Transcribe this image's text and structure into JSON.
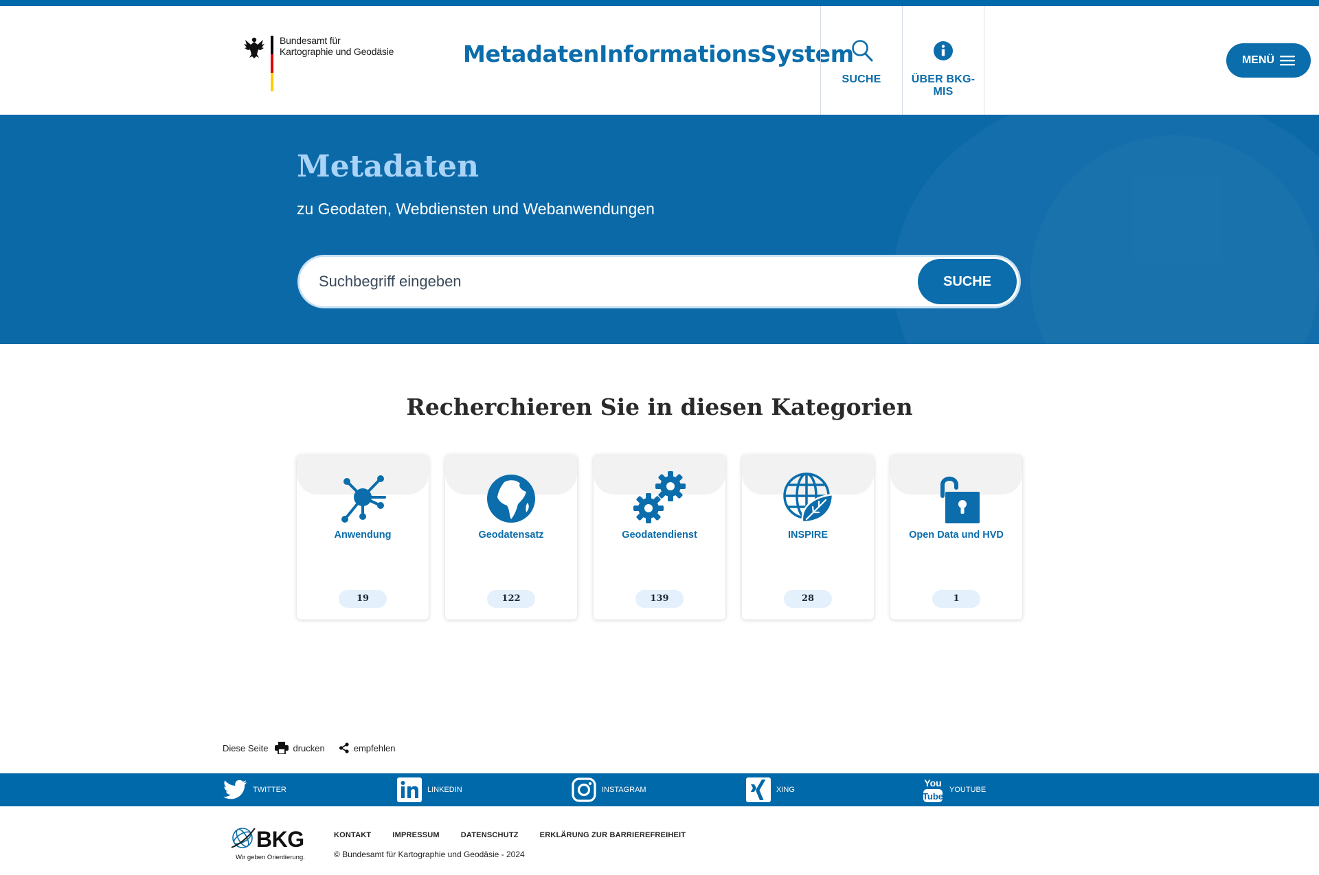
{
  "header": {
    "agency_name_line1": "Bundesamt für",
    "agency_name_line2": "Kartographie und Geodäsie",
    "site_title": "MetadatenInformationsSystem",
    "nav": [
      {
        "label": "SUCHE",
        "icon": "search-icon"
      },
      {
        "label": "ÜBER BKG-MIS",
        "icon": "info-icon"
      }
    ],
    "menu_label": "MENÜ"
  },
  "hero": {
    "title": "Metadaten",
    "subtitle": "zu Geodaten, Webdiensten und Webanwendungen",
    "search_placeholder": "Suchbegriff eingeben",
    "search_button": "SUCHE"
  },
  "categories": {
    "title": "Recherchieren Sie in diesen Kategorien",
    "items": [
      {
        "label": "Anwendung",
        "count": "19",
        "icon": "network-icon"
      },
      {
        "label": "Geodatensatz",
        "count": "122",
        "icon": "globe-africa-icon"
      },
      {
        "label": "Geodatendienst",
        "count": "139",
        "icon": "gears-icon"
      },
      {
        "label": "INSPIRE",
        "count": "28",
        "icon": "globe-leaf-icon"
      },
      {
        "label": "Open Data und HVD",
        "count": "1",
        "icon": "unlocked-padlock-icon"
      }
    ]
  },
  "page_tools": {
    "label": "Diese Seite",
    "print": "drucken",
    "share": "empfehlen"
  },
  "social": [
    {
      "label": "TWITTER",
      "icon": "twitter-icon"
    },
    {
      "label": "LINKEDIN",
      "icon": "linkedin-icon"
    },
    {
      "label": "INSTAGRAM",
      "icon": "instagram-icon"
    },
    {
      "label": "XING",
      "icon": "xing-icon"
    },
    {
      "label": "YOUTUBE",
      "icon": "youtube-icon"
    }
  ],
  "footer": {
    "logo_text": "BKG",
    "logo_tagline": "Wir geben Orientierung.",
    "links": [
      "KONTAKT",
      "IMPRESSUM",
      "DATENSCHUTZ",
      "ERKLÄRUNG ZUR BARRIEREFREIHEIT"
    ],
    "copyright": "© Bundesamt für Kartographie und Geodäsie - 2024"
  },
  "colors": {
    "brand_blue": "#0b6dab",
    "hero_blue": "#0b69a8",
    "hero_title": "#a9d3f7",
    "flag_black": "#000000",
    "flag_red": "#dd0000",
    "flag_gold": "#ffcc00"
  }
}
